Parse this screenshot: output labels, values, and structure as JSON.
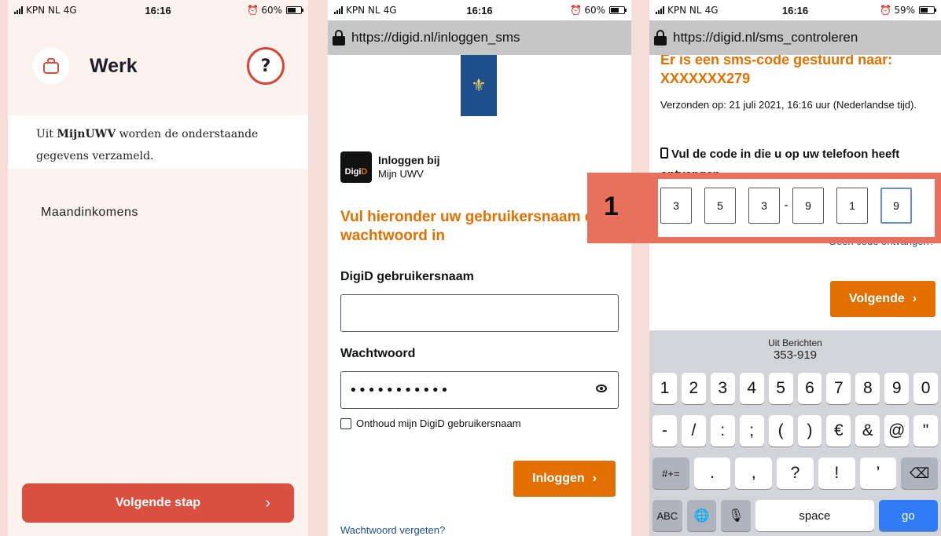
{
  "statusbar1": {
    "carrier": "KPN NL",
    "network": "4G",
    "time": "16:16",
    "battery": "60%",
    "battery_level": 0.6
  },
  "statusbar2": {
    "carrier": "KPN NL",
    "network": "4G",
    "time": "16:16",
    "battery": "60%",
    "battery_level": 0.6
  },
  "statusbar3": {
    "carrier": "KPN NL",
    "network": "4G",
    "time": "16:16",
    "battery": "59%",
    "battery_level": 0.59
  },
  "screen1": {
    "title": "Werk",
    "help_label": "?",
    "info_prefix": "Uit ",
    "info_brand": "MijnUWV",
    "info_suffix": " worden de onderstaande gegevens verzameld.",
    "item": "Maandinkomens",
    "next_label": "Volgende stap",
    "next_chevron": "›"
  },
  "screen2": {
    "url": "https://digid.nl/inloggen_sms",
    "digid_logo_a": "Digi",
    "digid_logo_b": "D",
    "login_title": "Inloggen bij",
    "login_sub": "Mijn UWV",
    "heading": "Vul hieronder uw gebruikersnaam en wachtwoord in",
    "username_label": "DigiD gebruikersnaam",
    "username_value": "",
    "password_label": "Wachtwoord",
    "password_value": "•••••••••••",
    "remember_label": "Onthoud mijn DigiD gebruikersnaam",
    "login_button": "Inloggen",
    "login_chevron": "›",
    "forgot_link": "Wachtwoord vergeten?"
  },
  "screen3": {
    "url": "https://digid.nl/sms_controleren",
    "heading_line1": "Er is een sms-code gestuurd naar:",
    "heading_line2": "XXXXXXX279",
    "sent_text": "Verzonden op: 21 juli 2021, 16:16 uur (Nederlandse tijd).",
    "instruct_text": "Vul de code in die u op uw telefoon heeft ontvangen",
    "code_digits": [
      "3",
      "5",
      "3",
      "9",
      "1",
      "9"
    ],
    "code_dash": "-",
    "no_code_link": "Geen code ontvangen?",
    "next_button": "Volgende",
    "next_chevron": "›",
    "overlay_number": "1"
  },
  "keyboard": {
    "suggest_title": "Uit Berichten",
    "suggest_value": "353-919",
    "row1": [
      "1",
      "2",
      "3",
      "4",
      "5",
      "6",
      "7",
      "8",
      "9",
      "0"
    ],
    "row2": [
      "-",
      "/",
      ":",
      ";",
      "(",
      ")",
      "€",
      "&",
      "@",
      "\""
    ],
    "row3_left": "#+=",
    "row3": [
      ".",
      ",",
      "?",
      "!",
      "’"
    ],
    "backspace": "⌫",
    "abc": "ABC",
    "globe": "🌐",
    "mic": "🎙",
    "space": "space",
    "go": "go"
  },
  "colors": {
    "accent_orange": "#e17000",
    "uwv_red": "#d94f40",
    "digid_blue": "#1e4f8a",
    "overlay": "#e8715e"
  }
}
